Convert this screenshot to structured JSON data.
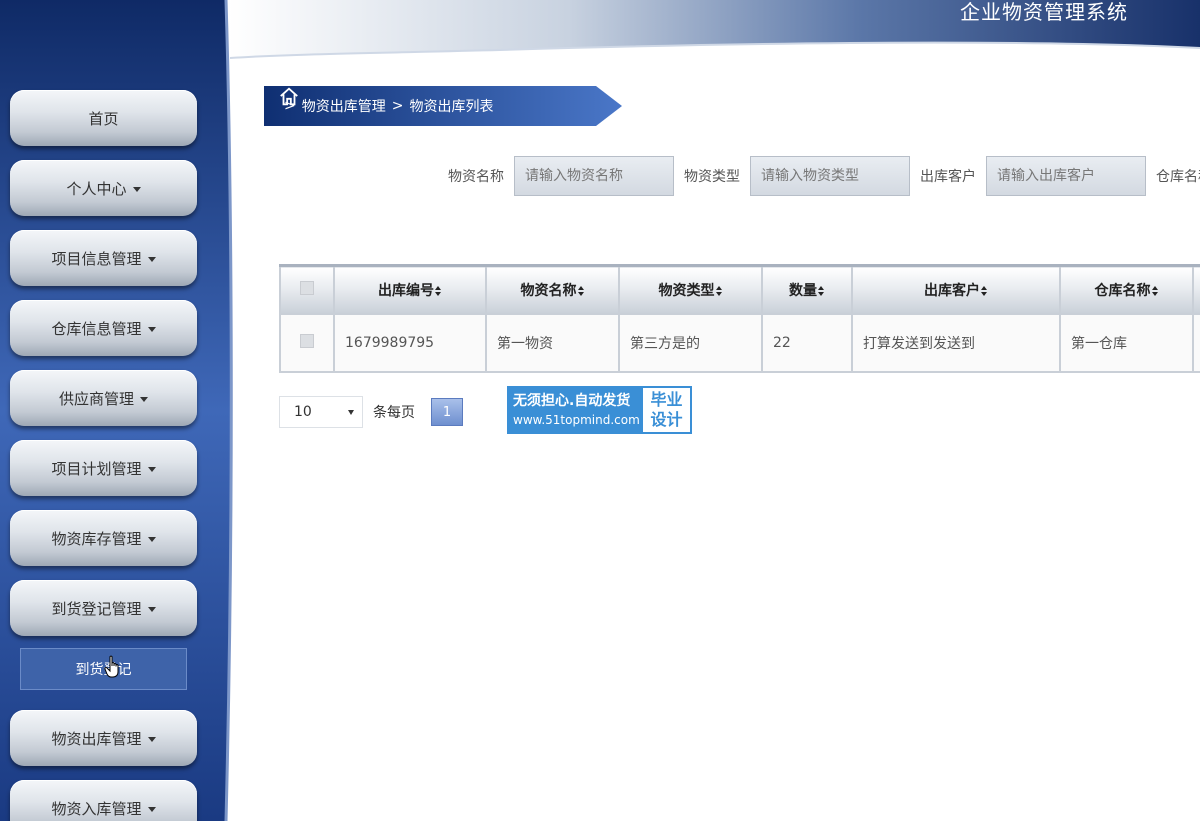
{
  "app": {
    "title": "企业物资管理系统"
  },
  "sidebar": {
    "items": [
      {
        "label": "首页",
        "has_caret": false
      },
      {
        "label": "个人中心",
        "has_caret": true
      },
      {
        "label": "项目信息管理",
        "has_caret": true
      },
      {
        "label": "仓库信息管理",
        "has_caret": true
      },
      {
        "label": "供应商管理",
        "has_caret": true
      },
      {
        "label": "项目计划管理",
        "has_caret": true
      },
      {
        "label": "物资库存管理",
        "has_caret": true
      },
      {
        "label": "到货登记管理",
        "has_caret": true
      },
      {
        "label": "物资出库管理",
        "has_caret": true
      },
      {
        "label": "物资入库管理",
        "has_caret": true
      }
    ],
    "submenu": {
      "label": "到货登记"
    }
  },
  "breadcrumb": {
    "separator": ">",
    "items": [
      "物资出库管理",
      "物资出库列表"
    ]
  },
  "search": {
    "fields": [
      {
        "label": "物资名称",
        "placeholder": "请输入物资名称"
      },
      {
        "label": "物资类型",
        "placeholder": "请输入物资类型"
      },
      {
        "label": "出库客户",
        "placeholder": "请输入出库客户"
      },
      {
        "label": "仓库名称",
        "placeholder": ""
      }
    ]
  },
  "table": {
    "columns": [
      "出库编号",
      "物资名称",
      "物资类型",
      "数量",
      "出库客户",
      "仓库名称"
    ],
    "rows": [
      [
        "1679989795",
        "第一物资",
        "第三方是的",
        "22",
        "打算发送到发送到",
        "第一仓库"
      ]
    ]
  },
  "pagination": {
    "page_size": "10",
    "per_page_label": "条每页",
    "current_page": "1"
  },
  "watermark": {
    "line1": "无须担心.自动发货",
    "line2": "www.51topmind.com",
    "badge_line1": "毕业",
    "badge_line2": "设计"
  },
  "colors": {
    "sidebar_dark": "#163677",
    "sidebar_light": "#3f68b8",
    "accent": "#3a8fd6",
    "header_dark": "#18316a"
  }
}
